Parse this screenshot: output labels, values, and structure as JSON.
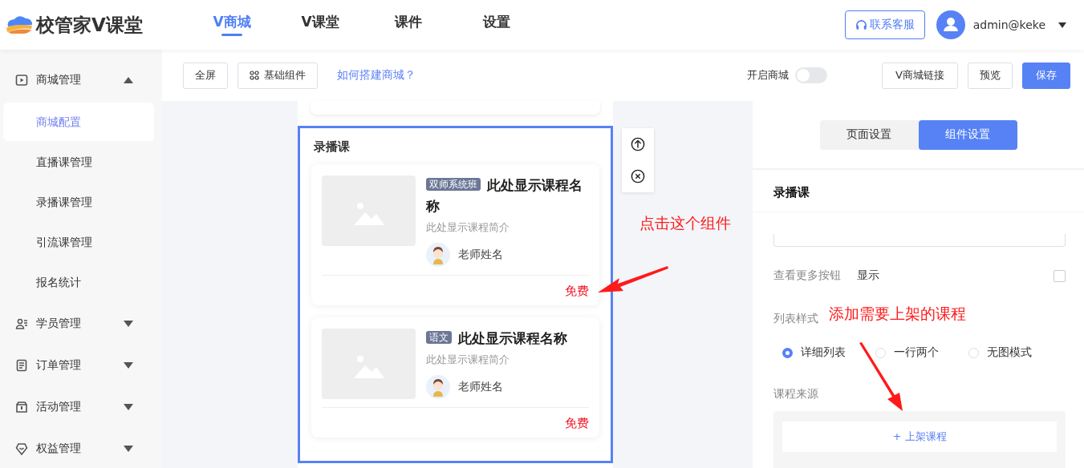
{
  "header": {
    "logo": "校管家V课堂",
    "nav": [
      {
        "label": "V商城",
        "selected": true
      },
      {
        "label": "V课堂",
        "selected": false
      },
      {
        "label": "课件",
        "selected": false
      },
      {
        "label": "设置",
        "selected": false
      }
    ],
    "service_button": "联系客服",
    "user": "admin@keke"
  },
  "sidebar": [
    {
      "label": "商城管理",
      "expanded": true,
      "children": [
        {
          "label": "商城配置",
          "selected": true
        },
        {
          "label": "直播课管理",
          "selected": false
        },
        {
          "label": "录播课管理",
          "selected": false
        },
        {
          "label": "引流课管理",
          "selected": false
        },
        {
          "label": "报名统计",
          "selected": false
        }
      ]
    },
    {
      "label": "学员管理",
      "expanded": false
    },
    {
      "label": "订单管理",
      "expanded": false
    },
    {
      "label": "活动管理",
      "expanded": false
    },
    {
      "label": "权益管理",
      "expanded": false
    }
  ],
  "toolbar": {
    "fullscreen": "全屏",
    "components": "基础组件",
    "help_link": "如何搭建商城？",
    "switch_label": "开启商城",
    "switch_on": false,
    "link_button": "V商城链接",
    "preview": "预览",
    "save": "保存"
  },
  "preview": {
    "section_title": "录播课",
    "courses": [
      {
        "tag": "双师系统班",
        "name": "此处显示课程名称",
        "intro": "此处显示课程简介",
        "teacher": "老师姓名",
        "price": "免费"
      },
      {
        "tag": "语文",
        "name": "此处显示课程名称",
        "intro": "此处显示课程简介",
        "teacher": "老师姓名",
        "price": "免费"
      }
    ]
  },
  "settings": {
    "tabs": [
      {
        "label": "页面设置",
        "selected": false
      },
      {
        "label": "组件设置",
        "selected": true
      }
    ],
    "title": "录播课",
    "more_button": {
      "label": "查看更多按钮",
      "value": "显示",
      "checked": false
    },
    "list_style": {
      "label": "列表样式",
      "options": [
        {
          "label": "详细列表",
          "selected": true
        },
        {
          "label": "一行两个",
          "selected": false
        },
        {
          "label": "无图模式",
          "selected": false
        }
      ]
    },
    "source_label": "课程来源",
    "add_button": "+ 上架课程"
  },
  "annotations": [
    "点击这个组件",
    "添加需要上架的课程"
  ]
}
